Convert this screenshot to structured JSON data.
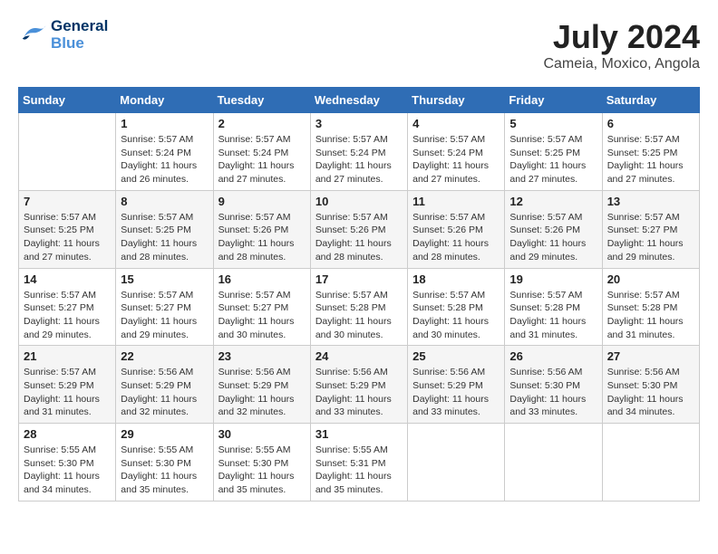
{
  "header": {
    "logo_line1": "General",
    "logo_line2": "Blue",
    "month_year": "July 2024",
    "location": "Cameia, Moxico, Angola"
  },
  "days_of_week": [
    "Sunday",
    "Monday",
    "Tuesday",
    "Wednesday",
    "Thursday",
    "Friday",
    "Saturday"
  ],
  "weeks": [
    [
      {
        "day": "",
        "info": ""
      },
      {
        "day": "1",
        "info": "Sunrise: 5:57 AM\nSunset: 5:24 PM\nDaylight: 11 hours\nand 26 minutes."
      },
      {
        "day": "2",
        "info": "Sunrise: 5:57 AM\nSunset: 5:24 PM\nDaylight: 11 hours\nand 27 minutes."
      },
      {
        "day": "3",
        "info": "Sunrise: 5:57 AM\nSunset: 5:24 PM\nDaylight: 11 hours\nand 27 minutes."
      },
      {
        "day": "4",
        "info": "Sunrise: 5:57 AM\nSunset: 5:24 PM\nDaylight: 11 hours\nand 27 minutes."
      },
      {
        "day": "5",
        "info": "Sunrise: 5:57 AM\nSunset: 5:25 PM\nDaylight: 11 hours\nand 27 minutes."
      },
      {
        "day": "6",
        "info": "Sunrise: 5:57 AM\nSunset: 5:25 PM\nDaylight: 11 hours\nand 27 minutes."
      }
    ],
    [
      {
        "day": "7",
        "info": "Sunrise: 5:57 AM\nSunset: 5:25 PM\nDaylight: 11 hours\nand 27 minutes."
      },
      {
        "day": "8",
        "info": "Sunrise: 5:57 AM\nSunset: 5:25 PM\nDaylight: 11 hours\nand 28 minutes."
      },
      {
        "day": "9",
        "info": "Sunrise: 5:57 AM\nSunset: 5:26 PM\nDaylight: 11 hours\nand 28 minutes."
      },
      {
        "day": "10",
        "info": "Sunrise: 5:57 AM\nSunset: 5:26 PM\nDaylight: 11 hours\nand 28 minutes."
      },
      {
        "day": "11",
        "info": "Sunrise: 5:57 AM\nSunset: 5:26 PM\nDaylight: 11 hours\nand 28 minutes."
      },
      {
        "day": "12",
        "info": "Sunrise: 5:57 AM\nSunset: 5:26 PM\nDaylight: 11 hours\nand 29 minutes."
      },
      {
        "day": "13",
        "info": "Sunrise: 5:57 AM\nSunset: 5:27 PM\nDaylight: 11 hours\nand 29 minutes."
      }
    ],
    [
      {
        "day": "14",
        "info": "Sunrise: 5:57 AM\nSunset: 5:27 PM\nDaylight: 11 hours\nand 29 minutes."
      },
      {
        "day": "15",
        "info": "Sunrise: 5:57 AM\nSunset: 5:27 PM\nDaylight: 11 hours\nand 29 minutes."
      },
      {
        "day": "16",
        "info": "Sunrise: 5:57 AM\nSunset: 5:27 PM\nDaylight: 11 hours\nand 30 minutes."
      },
      {
        "day": "17",
        "info": "Sunrise: 5:57 AM\nSunset: 5:28 PM\nDaylight: 11 hours\nand 30 minutes."
      },
      {
        "day": "18",
        "info": "Sunrise: 5:57 AM\nSunset: 5:28 PM\nDaylight: 11 hours\nand 30 minutes."
      },
      {
        "day": "19",
        "info": "Sunrise: 5:57 AM\nSunset: 5:28 PM\nDaylight: 11 hours\nand 31 minutes."
      },
      {
        "day": "20",
        "info": "Sunrise: 5:57 AM\nSunset: 5:28 PM\nDaylight: 11 hours\nand 31 minutes."
      }
    ],
    [
      {
        "day": "21",
        "info": "Sunrise: 5:57 AM\nSunset: 5:29 PM\nDaylight: 11 hours\nand 31 minutes."
      },
      {
        "day": "22",
        "info": "Sunrise: 5:56 AM\nSunset: 5:29 PM\nDaylight: 11 hours\nand 32 minutes."
      },
      {
        "day": "23",
        "info": "Sunrise: 5:56 AM\nSunset: 5:29 PM\nDaylight: 11 hours\nand 32 minutes."
      },
      {
        "day": "24",
        "info": "Sunrise: 5:56 AM\nSunset: 5:29 PM\nDaylight: 11 hours\nand 33 minutes."
      },
      {
        "day": "25",
        "info": "Sunrise: 5:56 AM\nSunset: 5:29 PM\nDaylight: 11 hours\nand 33 minutes."
      },
      {
        "day": "26",
        "info": "Sunrise: 5:56 AM\nSunset: 5:30 PM\nDaylight: 11 hours\nand 33 minutes."
      },
      {
        "day": "27",
        "info": "Sunrise: 5:56 AM\nSunset: 5:30 PM\nDaylight: 11 hours\nand 34 minutes."
      }
    ],
    [
      {
        "day": "28",
        "info": "Sunrise: 5:55 AM\nSunset: 5:30 PM\nDaylight: 11 hours\nand 34 minutes."
      },
      {
        "day": "29",
        "info": "Sunrise: 5:55 AM\nSunset: 5:30 PM\nDaylight: 11 hours\nand 35 minutes."
      },
      {
        "day": "30",
        "info": "Sunrise: 5:55 AM\nSunset: 5:30 PM\nDaylight: 11 hours\nand 35 minutes."
      },
      {
        "day": "31",
        "info": "Sunrise: 5:55 AM\nSunset: 5:31 PM\nDaylight: 11 hours\nand 35 minutes."
      },
      {
        "day": "",
        "info": ""
      },
      {
        "day": "",
        "info": ""
      },
      {
        "day": "",
        "info": ""
      }
    ]
  ]
}
